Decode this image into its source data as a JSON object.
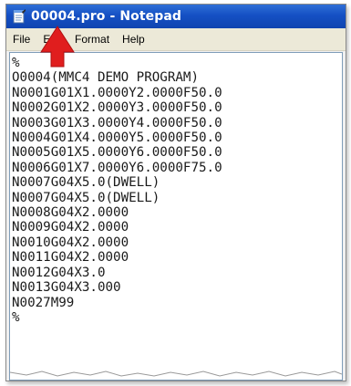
{
  "window": {
    "title": "00004.pro - Notepad",
    "app_icon": "notepad-icon"
  },
  "menu": {
    "items": [
      {
        "label": "File"
      },
      {
        "label": "Edit"
      },
      {
        "label": "Format"
      },
      {
        "label": "Help"
      }
    ]
  },
  "annotation": {
    "icon": "red-arrow-pointer",
    "color": "#e01e1e"
  },
  "editor": {
    "lines": [
      "%",
      "O0004(MMC4 DEMO PROGRAM)",
      "N0001G01X1.0000Y2.0000F50.0",
      "N0002G01X2.0000Y3.0000F50.0",
      "N0003G01X3.0000Y4.0000F50.0",
      "N0004G01X4.0000Y5.0000F50.0",
      "N0005G01X5.0000Y6.0000F50.0",
      "N0006G01X7.0000Y6.0000F75.0",
      "N0007G04X5.0(DWELL)",
      "N0007G04X5.0(DWELL)",
      "N0008G04X2.0000",
      "N0009G04X2.0000",
      "N0010G04X2.0000",
      "N0011G04X2.0000",
      "N0012G04X3.0",
      "N0013G04X3.000",
      "N0027M99",
      "%"
    ]
  }
}
